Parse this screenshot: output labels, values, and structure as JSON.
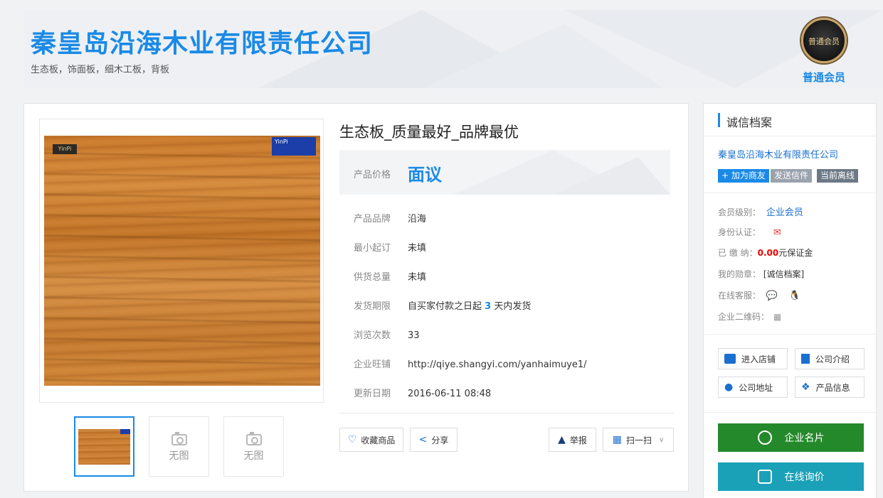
{
  "header": {
    "company_name": "秦皇岛沿海木业有限责任公司",
    "business_scope": "生态板，饰面板，细木工板，背板",
    "badge_text": "普通会员",
    "member_level": "普通会员"
  },
  "product": {
    "title": "生态板_质量最好_品牌最优",
    "price_label": "产品价格",
    "price_value": "面议",
    "thumbnails": [
      {
        "kind": "image"
      },
      {
        "kind": "none",
        "text": "无图"
      },
      {
        "kind": "none",
        "text": "无图"
      }
    ],
    "attributes": [
      {
        "key": "产品品牌",
        "value": "沿海"
      },
      {
        "key": "最小起订",
        "value": "未填"
      },
      {
        "key": "供货总量",
        "value": "未填"
      },
      {
        "key": "发货期限",
        "value_prefix": "自买家付款之日起",
        "value_num": "3",
        "value_suffix": "天内发货"
      },
      {
        "key": "浏览次数",
        "value": "33"
      },
      {
        "key": "企业旺铺",
        "value": "http://qiye.shangyi.com/yanhaimuye1/"
      },
      {
        "key": "更新日期",
        "value": "2016-06-11 08:48"
      }
    ],
    "actions": {
      "favorite": "收藏商品",
      "share": "分享",
      "report": "举报",
      "scan": "扫一扫"
    }
  },
  "side": {
    "title": "诚信档案",
    "company_name": "秦皇岛沿海木业有限责任公司",
    "tags": [
      "+ 加为商友",
      "发送信件",
      "当前离线"
    ],
    "tag_colors": [
      "#1a8ae6",
      "#9aa2ad",
      "#6c7885"
    ],
    "level_label": "会员级别：",
    "level_value": "企业会员",
    "identity_label": "身份认证：",
    "paid_label": "已   缴   纳：",
    "paid_amount": "0.00",
    "paid_unit": "元保证金",
    "medal_label": "我的勋章：",
    "medal_value": "[诚信档案]",
    "service_label": "在线客服：",
    "qr_label": "企业二维码：",
    "links": {
      "shop": "进入店铺",
      "intro": "公司介绍",
      "address": "公司地址",
      "products": "产品信息"
    },
    "card_button": "企业名片",
    "inquiry_button": "在线询价",
    "card_color": "#24892b",
    "inquiry_color": "#1aa1b8"
  }
}
